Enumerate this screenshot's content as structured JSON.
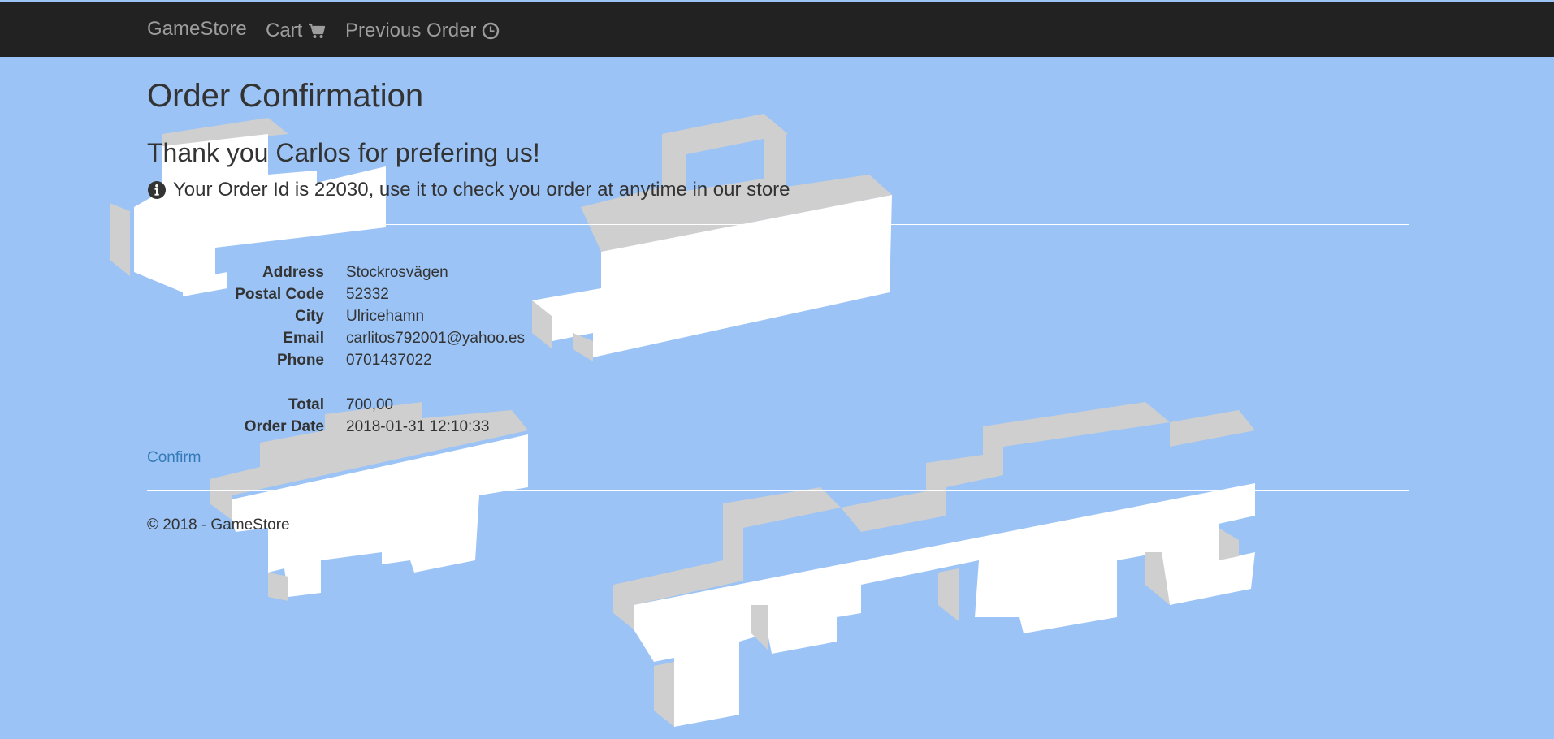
{
  "navbar": {
    "brand": "GameStore",
    "cart_label": "Cart",
    "previous_order_label": "Previous Order",
    "background": "#222222",
    "link_color": "#9d9d9d",
    "cart_icon": "shopping-cart-icon",
    "previous_order_icon": "clock-icon"
  },
  "page": {
    "title": "Order Confirmation",
    "thank_you": "Thank you Carlos for prefering us!",
    "order_id_message": "Your Order Id is 22030, use it to check you order at anytime in our store",
    "order_id_icon": "info-circle-icon",
    "background": "#9bc3f5"
  },
  "details": [
    {
      "label": "Address",
      "value": "Stockrosvägen"
    },
    {
      "label": "Postal Code",
      "value": "52332"
    },
    {
      "label": "City",
      "value": "Ulricehamn"
    },
    {
      "label": "Email",
      "value": "carlitos792001@yahoo.es"
    },
    {
      "label": "Phone",
      "value": "0701437022"
    },
    {
      "label": "Total",
      "value": "700,00"
    },
    {
      "label": "Order Date",
      "value": "2018-01-31 12:10:33"
    }
  ],
  "actions": {
    "confirm_label": "Confirm",
    "link_color": "#337ab7"
  },
  "footer": {
    "text": "© 2018 - GameStore"
  }
}
